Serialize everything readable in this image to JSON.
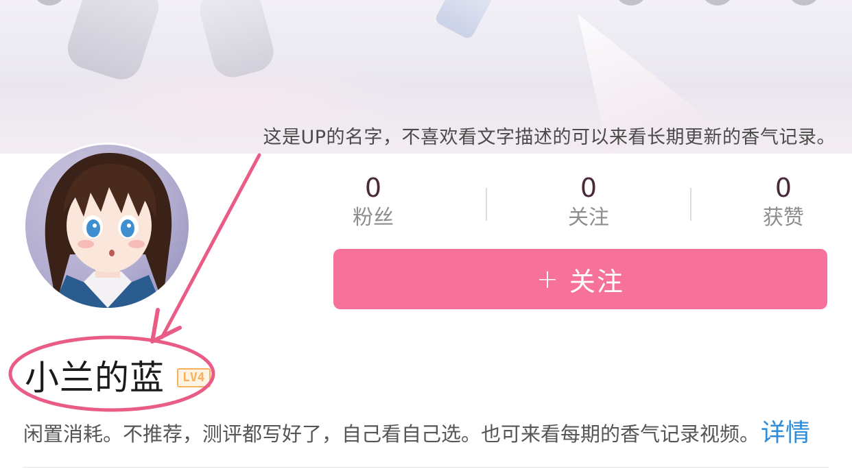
{
  "banner": {
    "caption": "这是UP的名字，不喜欢看文字描述的可以来看长期更新的香气记录。"
  },
  "stats": [
    {
      "value": "0",
      "label": "粉丝"
    },
    {
      "value": "0",
      "label": "关注"
    },
    {
      "value": "0",
      "label": "获赞"
    }
  ],
  "follow_button": {
    "icon": "plus-icon",
    "label": "关注"
  },
  "profile": {
    "name": "小兰的蓝",
    "level_badge": "LV4",
    "bio": "闲置消耗。不推荐，测评都写好了，自己看自己选。也可来看每期的香气记录视频。",
    "more_link": "详情"
  },
  "colors": {
    "accent": "#f7729b",
    "annotation": "#e95c86",
    "link": "#2e8bd8",
    "badge": "#f5b25a"
  }
}
